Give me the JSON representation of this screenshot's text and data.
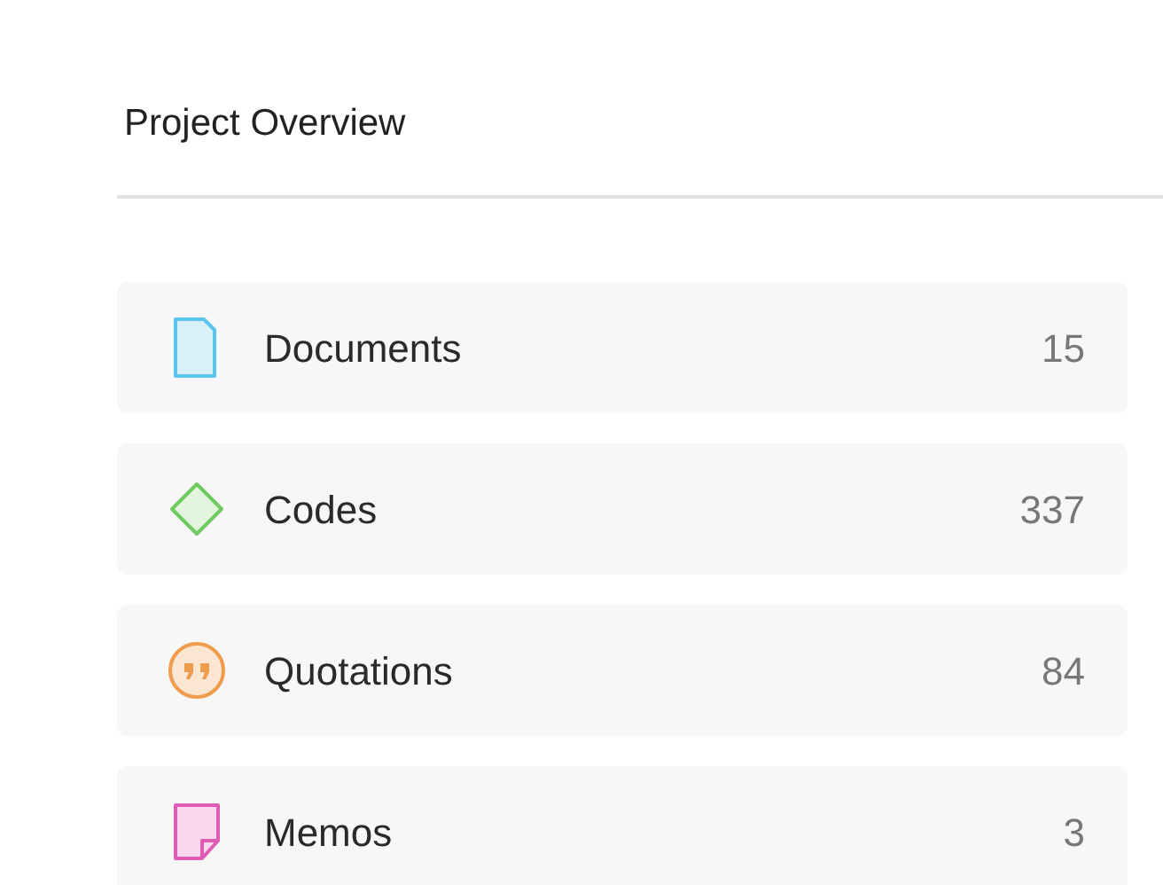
{
  "title": "Project Overview",
  "items": [
    {
      "kind": "document",
      "label": "Documents",
      "count": "15"
    },
    {
      "kind": "code",
      "label": "Codes",
      "count": "337"
    },
    {
      "kind": "quotation",
      "label": "Quotations",
      "count": "84"
    },
    {
      "kind": "memo",
      "label": "Memos",
      "count": "3"
    }
  ]
}
